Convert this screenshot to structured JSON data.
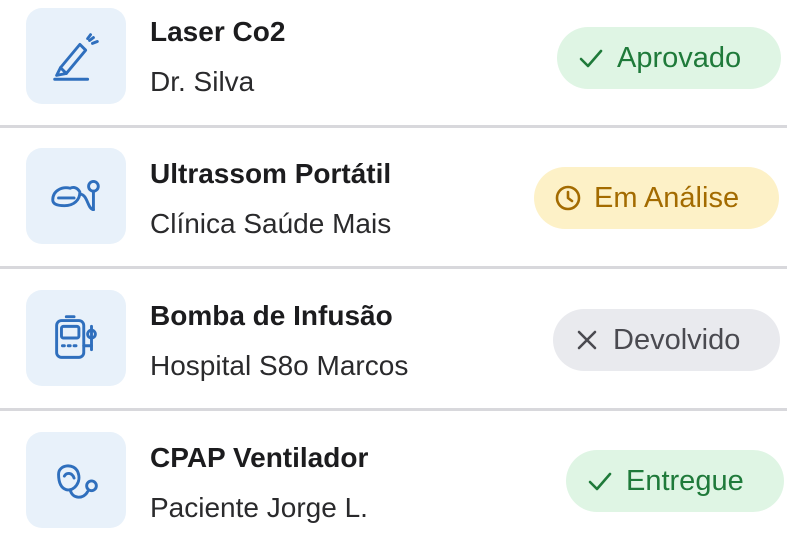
{
  "items": [
    {
      "title": "Laser Co2",
      "subtitle": "Dr. Silva",
      "status": "Aprovado",
      "status_icon": "check-icon",
      "device_icon": "laser-pen-icon",
      "badge_bg": "#dff5e4",
      "badge_fg": "#1f7a3a"
    },
    {
      "title": "Ultrassom Portátil",
      "subtitle": "Clínica Saúde Mais",
      "status": "Em Análise",
      "status_icon": "clock-icon",
      "device_icon": "ultrasound-probe-icon",
      "badge_bg": "#fdf1c7",
      "badge_fg": "#a36b00"
    },
    {
      "title": "Bomba de Infusão",
      "subtitle": "Hospital S8o Marcos",
      "status": "Devolvido",
      "status_icon": "close-icon",
      "device_icon": "infusion-pump-icon",
      "badge_bg": "#e9eaee",
      "badge_fg": "#4a4a50"
    },
    {
      "title": "CPAP Ventilador",
      "subtitle": "Paciente Jorge L.",
      "status": "Entregue",
      "status_icon": "check-icon",
      "device_icon": "cpap-mask-icon",
      "badge_bg": "#dff5e4",
      "badge_fg": "#1f7a3a"
    }
  ],
  "colors": {
    "icon_stroke": "#2f6fbd",
    "icon_bg": "#e8f1fa",
    "divider": "#d8d8dc"
  }
}
